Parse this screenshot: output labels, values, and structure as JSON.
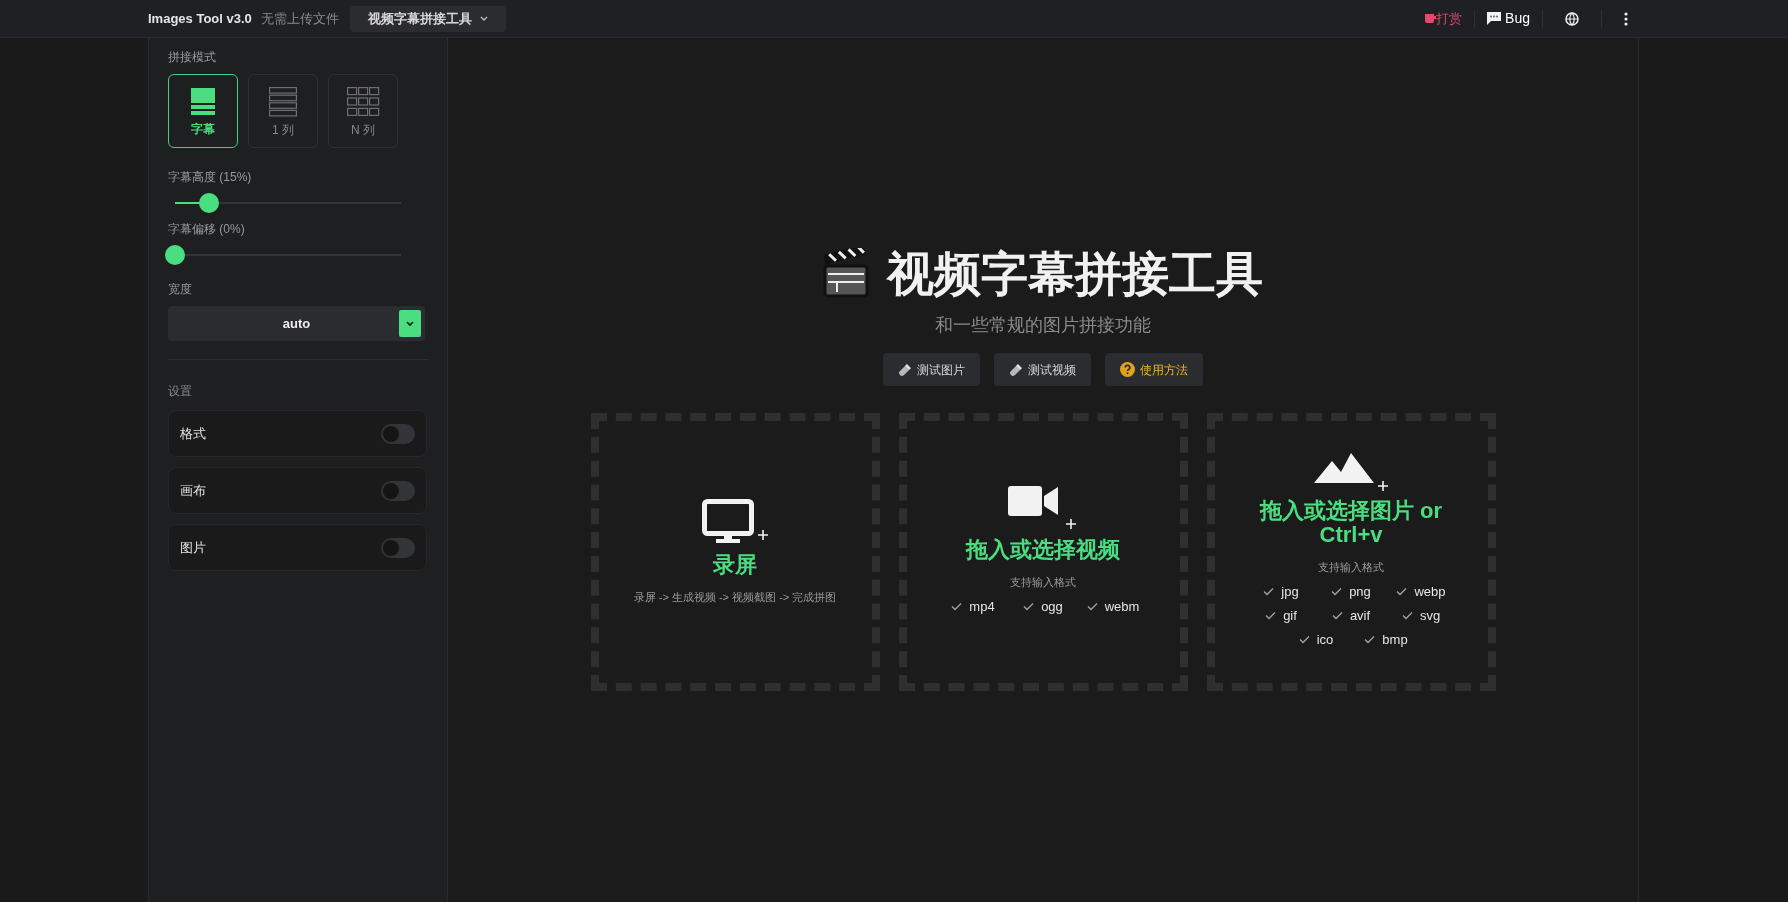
{
  "topbar": {
    "app_title": "Images Tool v3.0",
    "tagline": "无需上传文件",
    "tool_select": "视频字幕拼接工具",
    "actions": [
      {
        "kind": "donate",
        "label": "打赏"
      },
      {
        "kind": "bug",
        "label": "Bug"
      },
      {
        "kind": "language"
      },
      {
        "kind": "more"
      }
    ]
  },
  "sidebar": {
    "mode_label": "拼接模式",
    "modes": [
      {
        "kind": "subtitle",
        "label": "字幕",
        "selected": true
      },
      {
        "kind": "column",
        "label": "1 列",
        "selected": false
      },
      {
        "kind": "grid",
        "label": "N 列",
        "selected": false
      }
    ],
    "sliders": [
      {
        "label": "字幕高度 (15%)",
        "level": 0.15
      },
      {
        "label": "字幕偏移 (0%)",
        "level": 0
      }
    ],
    "width_label": "宽度",
    "width_value": "auto",
    "settings_label": "设置",
    "settings": [
      {
        "label": "格式",
        "on": false
      },
      {
        "label": "画布",
        "on": false
      },
      {
        "label": "图片",
        "on": false
      }
    ]
  },
  "main": {
    "title": "视频字幕拼接工具",
    "subtitle": "和一些常规的图片拼接功能",
    "buttons": [
      {
        "kind": "test",
        "label": "测试图片"
      },
      {
        "kind": "test",
        "label": "测试视频"
      },
      {
        "kind": "help",
        "label": "使用方法"
      }
    ],
    "dropzones": [
      {
        "kind": "screen",
        "title": "录屏",
        "description": "录屏 -> 生成视频 -> 视频截图 -> 完成拼图"
      },
      {
        "kind": "video",
        "title": "拖入或选择视频",
        "formats_label": "支持输入格式",
        "formats": [
          "mp4",
          "ogg",
          "webm"
        ]
      },
      {
        "kind": "image",
        "title": "拖入或选择图片 or Ctrl+v",
        "formats_label": "支持输入格式",
        "formats": [
          "jpg",
          "png",
          "webp",
          "gif",
          "avif",
          "svg",
          "ico",
          "bmp"
        ]
      }
    ]
  }
}
